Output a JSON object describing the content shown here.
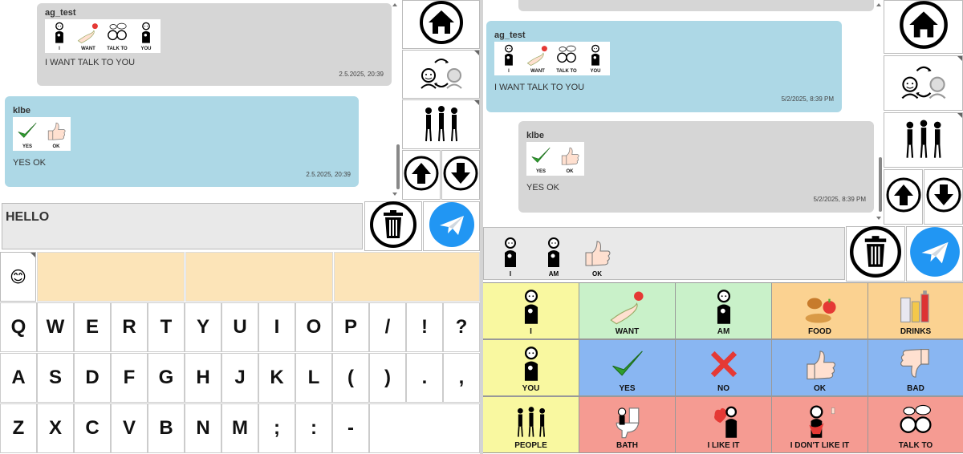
{
  "left": {
    "messages": [
      {
        "sender": "ag_test",
        "symbols": [
          {
            "label": "I",
            "icon": "person-icon"
          },
          {
            "label": "WANT",
            "icon": "hand-icon"
          },
          {
            "label": "TALK TO",
            "icon": "talk-icon"
          },
          {
            "label": "YOU",
            "icon": "person-icon"
          }
        ],
        "text": "I WANT TALK TO YOU",
        "time": "2.5.2025, 20:39"
      },
      {
        "sender": "klbe",
        "symbols": [
          {
            "label": "YES",
            "icon": "check-icon"
          },
          {
            "label": "OK",
            "icon": "thumbs-up-icon"
          }
        ],
        "text": "YES OK",
        "time": "2.5.2025, 20:39"
      }
    ],
    "input_text": "HELLO",
    "suggestion_emoji": "😊",
    "keyboard": [
      [
        "Q",
        "W",
        "E",
        "R",
        "T",
        "Y",
        "U",
        "I",
        "O",
        "P",
        "/",
        "!",
        "?"
      ],
      [
        "A",
        "S",
        "D",
        "F",
        "G",
        "H",
        "J",
        "K",
        "L",
        "(",
        ")",
        ".",
        ","
      ],
      [
        "Z",
        "X",
        "C",
        "V",
        "B",
        "N",
        "M",
        ";",
        ":",
        "-"
      ]
    ]
  },
  "right": {
    "messages": [
      {
        "sender": "ag_test",
        "symbols": [
          {
            "label": "I",
            "icon": "person-icon"
          },
          {
            "label": "WANT",
            "icon": "hand-icon"
          },
          {
            "label": "TALK TO",
            "icon": "talk-icon"
          },
          {
            "label": "YOU",
            "icon": "person-icon"
          }
        ],
        "text": "I WANT TALK TO YOU",
        "time": "5/2/2025, 8:39 PM"
      },
      {
        "sender": "klbe",
        "symbols": [
          {
            "label": "YES",
            "icon": "check-icon"
          },
          {
            "label": "OK",
            "icon": "thumbs-up-icon"
          }
        ],
        "text": "YES OK",
        "time": "5/2/2025, 8:39 PM"
      }
    ],
    "sentence": [
      {
        "label": "I",
        "icon": "person-icon"
      },
      {
        "label": "AM",
        "icon": "person-icon"
      },
      {
        "label": "OK",
        "icon": "thumbs-up-icon"
      }
    ],
    "grid": [
      [
        {
          "label": "I",
          "color": "yellow",
          "icon": "person-icon"
        },
        {
          "label": "WANT",
          "color": "green",
          "icon": "hand-icon"
        },
        {
          "label": "AM",
          "color": "green",
          "icon": "person-icon"
        },
        {
          "label": "FOOD",
          "color": "orange",
          "icon": "food-icon"
        },
        {
          "label": "DRINKS",
          "color": "orange",
          "icon": "drinks-icon"
        }
      ],
      [
        {
          "label": "YOU",
          "color": "yellow",
          "icon": "person-icon"
        },
        {
          "label": "YES",
          "color": "blue",
          "icon": "check-icon"
        },
        {
          "label": "NO",
          "color": "blue",
          "icon": "cross-icon"
        },
        {
          "label": "OK",
          "color": "blue",
          "icon": "thumbs-up-icon"
        },
        {
          "label": "BAD",
          "color": "blue",
          "icon": "thumbs-down-icon"
        }
      ],
      [
        {
          "label": "PEOPLE",
          "color": "yellow",
          "icon": "people-icon"
        },
        {
          "label": "BATH",
          "color": "red",
          "icon": "toilet-icon"
        },
        {
          "label": "I LIKE IT",
          "color": "red",
          "icon": "heart-icon"
        },
        {
          "label": "I DON'T LIKE IT",
          "color": "red",
          "icon": "dislike-icon"
        },
        {
          "label": "TALK TO",
          "color": "red",
          "icon": "talk-icon"
        }
      ]
    ]
  },
  "colors": {
    "grid_yellow": "#f9f8a0",
    "grid_green": "#c9f1c9",
    "grid_orange": "#fbd291",
    "grid_blue": "#89b6f2",
    "grid_red": "#f59b92",
    "bubble_blue": "#add8e6",
    "bubble_grey": "#d6d6d6",
    "send_blue": "#2196f3"
  }
}
